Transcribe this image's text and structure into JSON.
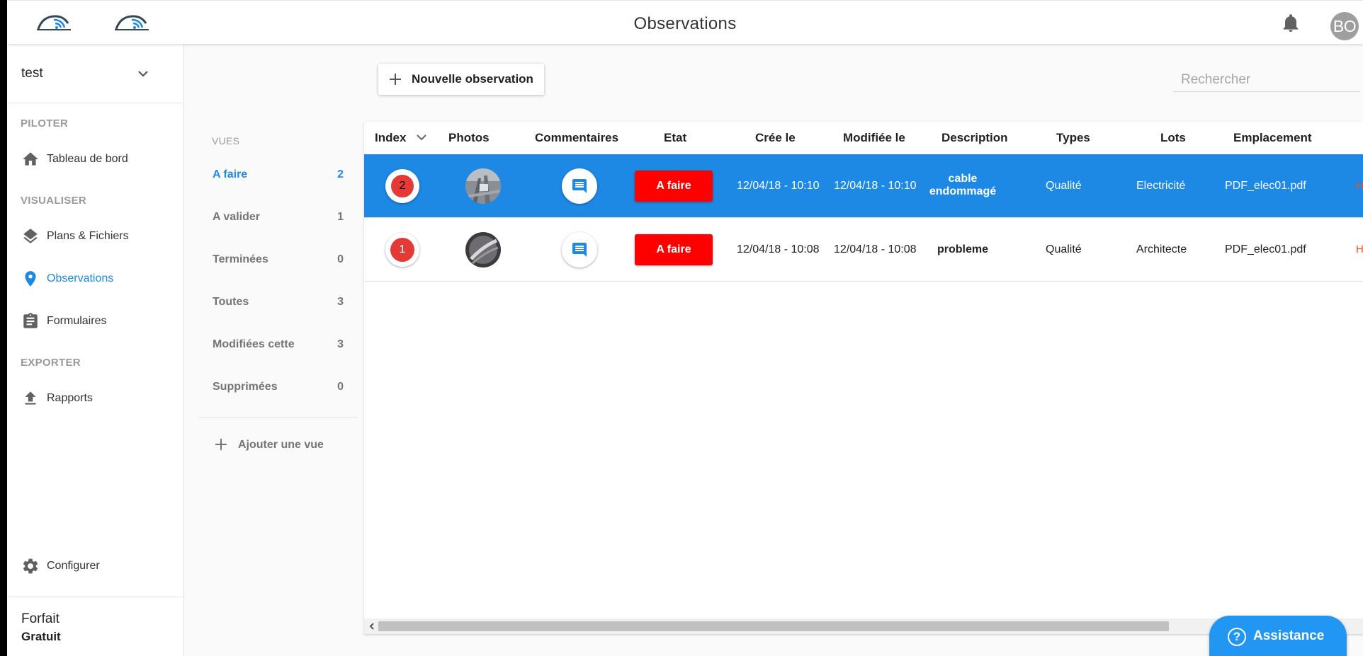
{
  "header": {
    "title": "Observations",
    "avatar_initials": "BO"
  },
  "sidebar": {
    "project": "test",
    "sections": {
      "piloter": "PILOTER",
      "visualiser": "VISUALISER",
      "exporter": "EXPORTER"
    },
    "items": {
      "dashboard": "Tableau de bord",
      "plans": "Plans & Fichiers",
      "observations": "Observations",
      "forms": "Formulaires",
      "reports": "Rapports"
    },
    "configure": "Configurer",
    "plan_label": "Forfait",
    "plan_value": "Gratuit"
  },
  "views": {
    "title": "VUES",
    "items": [
      {
        "label": "A faire",
        "count": "2"
      },
      {
        "label": "A valider",
        "count": "1"
      },
      {
        "label": "Terminées",
        "count": "0"
      },
      {
        "label": "Toutes",
        "count": "3"
      },
      {
        "label": "Modifiées cette",
        "count": "3"
      },
      {
        "label": "Supprimées",
        "count": "0"
      }
    ],
    "add_view": "Ajouter une vue"
  },
  "toolbar": {
    "new_observation": "Nouvelle observation",
    "search_placeholder": "Rechercher"
  },
  "table": {
    "columns": [
      "Index",
      "Photos",
      "Commentaires",
      "Etat",
      "Crée le",
      "Modifiée le",
      "Description",
      "Types",
      "Lots",
      "Emplacement"
    ],
    "rows": [
      {
        "index": "2",
        "state": "A faire",
        "created": "12/04/18 - 10:10",
        "modified": "12/04/18 - 10:10",
        "description_line1": "cable",
        "description_line2": "endommagé",
        "type": "Qualité",
        "lot": "Electricité",
        "location": "PDF_elec01.pdf",
        "edge": "H"
      },
      {
        "index": "1",
        "state": "A faire",
        "created": "12/04/18 - 10:08",
        "modified": "12/04/18 - 10:08",
        "description_line1": "probleme",
        "description_line2": "",
        "type": "Qualité",
        "lot": "Architecte",
        "location": "PDF_elec01.pdf",
        "edge": "H"
      }
    ]
  },
  "assistance": {
    "label": "Assistance"
  },
  "colors": {
    "accent": "#1e88e5",
    "state_red": "#ff0000",
    "index_red": "#e53935",
    "assist_blue": "#2196f3"
  },
  "icons": [
    "logo-icon",
    "bell-icon",
    "chevron-down-icon",
    "home-icon",
    "layers-icon",
    "location-pin-icon",
    "clipboard-icon",
    "upload-icon",
    "gear-icon",
    "plus-icon",
    "comment-icon",
    "chevron-left-icon",
    "help-icon"
  ]
}
